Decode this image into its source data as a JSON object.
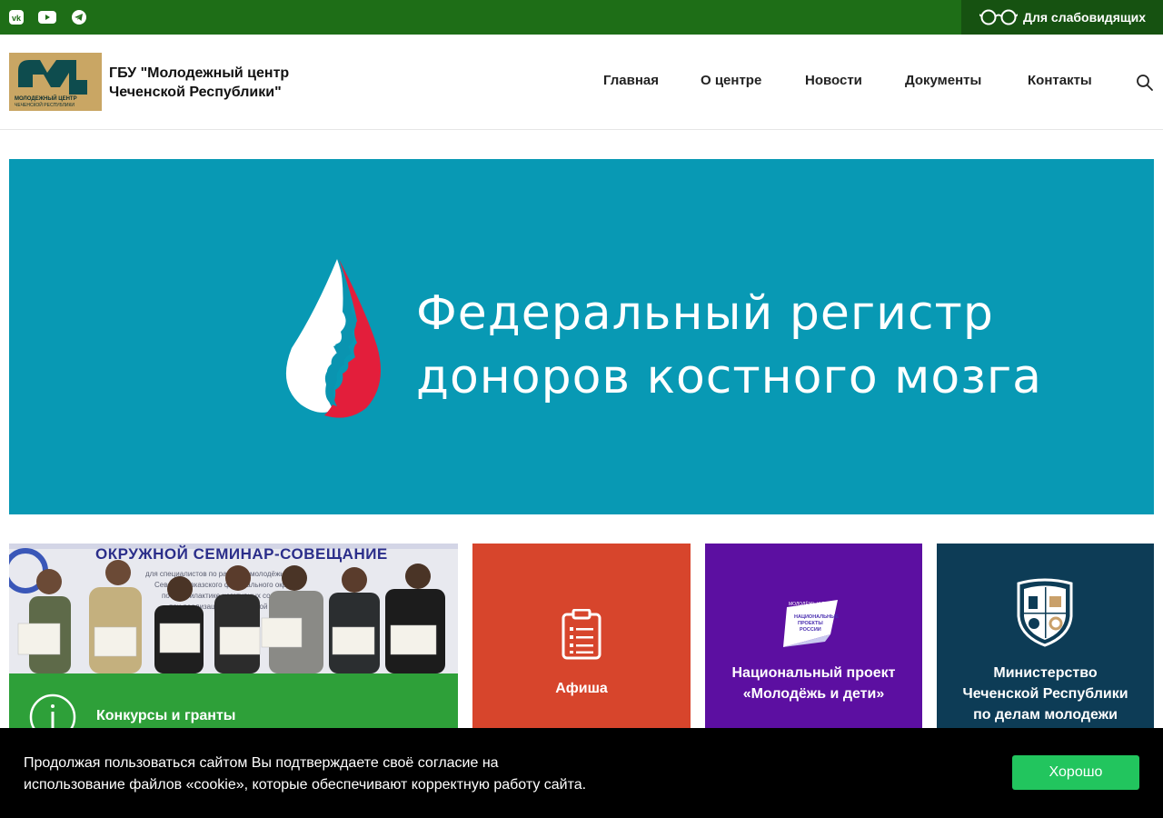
{
  "topbar": {
    "social_icons": [
      "vk-icon",
      "youtube-icon",
      "telegram-icon"
    ],
    "vision_label": "Для слабовидящих"
  },
  "header": {
    "logo_text": "МОЛОДЕЖНЫЙ ЦЕНТР ЧЕЧЕНСКОЙ РЕСПУБЛИКИ",
    "org_name_line1": "ГБУ \"Молодежный центр",
    "org_name_line2": "Чеченской Республики\"",
    "nav": [
      "Главная",
      "О центре",
      "Новости",
      "Документы",
      "Контакты"
    ]
  },
  "banner": {
    "line1": "Федеральный регистр",
    "line2": "доноров костного мозга"
  },
  "tiles": {
    "photo_heading": "ОКРУЖНОЙ СЕМИНАР-СОВЕЩАНИЕ",
    "competitions": "Конкурсы и гранты",
    "afisha": "Афиша",
    "national_project_line1": "Национальный проект",
    "national_project_line2": "«Молодёжь и дети»",
    "np_logo_small": "МОЛОДЁЖЬ И ДЕТИ",
    "np_logo_big": "НАЦИОНАЛЬНЫЕ ПРОЕКТЫ РОССИИ",
    "ministry_line1": "Министерство",
    "ministry_line2": "Чеченской Республики",
    "ministry_line3": "по делам молодежи"
  },
  "cookie": {
    "text_line1": "Продолжая пользоваться сайтом Вы подтверждаете своё согласие на",
    "text_line2": "использование файлов «cookie», которые обеспечивают корректную работу сайта.",
    "button": "Хорошо"
  },
  "colors": {
    "topbar": "#1e6e17",
    "banner": "#0899b4",
    "afisha": "#d7452c",
    "national_project": "#5c0fa1",
    "ministry": "#0d3c56",
    "accept": "#22c55e"
  }
}
